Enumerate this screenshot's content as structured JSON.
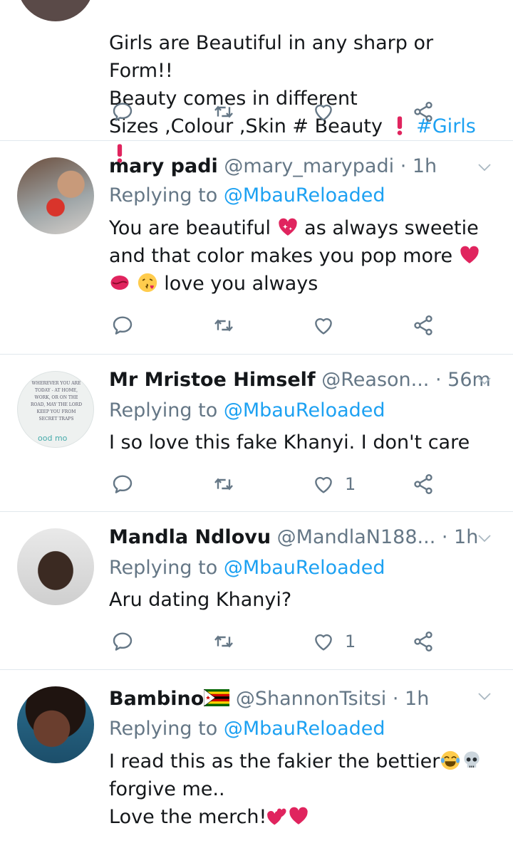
{
  "tweets": [
    {
      "body_text": "Girls are Beautiful in any sharp or Form!!\nBeauty comes in different\nSizes ,Colour ,Skin # Beauty ",
      "hashtag": "#Girls",
      "actions": {
        "reply": "",
        "retweet": "",
        "like": "",
        "share": ""
      }
    },
    {
      "name": "mary padi",
      "handle": "@mary_marypadi",
      "time": "· 1h",
      "replying_prefix": "Replying to ",
      "replying_to": "@MbauReloaded",
      "body_line1": "You are beautiful",
      "body_line1b": "as always sweetie",
      "body_line2": "and that color makes you pop more",
      "body_line3": "love you always",
      "like_count": ""
    },
    {
      "name": "Mr Mristoe Himself",
      "handle": "@Reason...",
      "time": "· 56m",
      "replying_prefix": "Replying to ",
      "replying_to": "@MbauReloaded",
      "body": "I so love this fake Khanyi. I don't care",
      "like_count": "1",
      "avatar_text": "WHEREVER YOU ARE TODAY - AT HOME, WORK, OR ON THE ROAD, MAY THE LORD KEEP YOU FROM SECRET TRAPS",
      "avatar_footer": "ood mo"
    },
    {
      "name": "Mandla Ndlovu",
      "handle": "@MandlaN188...",
      "time": "· 1h",
      "replying_prefix": "Replying to ",
      "replying_to": "@MbauReloaded",
      "body": "Aru dating Khanyi?",
      "like_count": "1"
    },
    {
      "name": "Bambino",
      "handle": "@ShannonTsitsi",
      "time": "· 1h",
      "replying_prefix": "Replying to ",
      "replying_to": "@MbauReloaded",
      "body_line1": "I read this as the fakier the bettier",
      "body_line2": "forgive me..",
      "body_line3": "Love the merch!"
    }
  ],
  "colors": {
    "accent": "#1da1f2",
    "muted": "#657786",
    "heart_red": "#e0245e",
    "divider": "#e1e8ed"
  }
}
